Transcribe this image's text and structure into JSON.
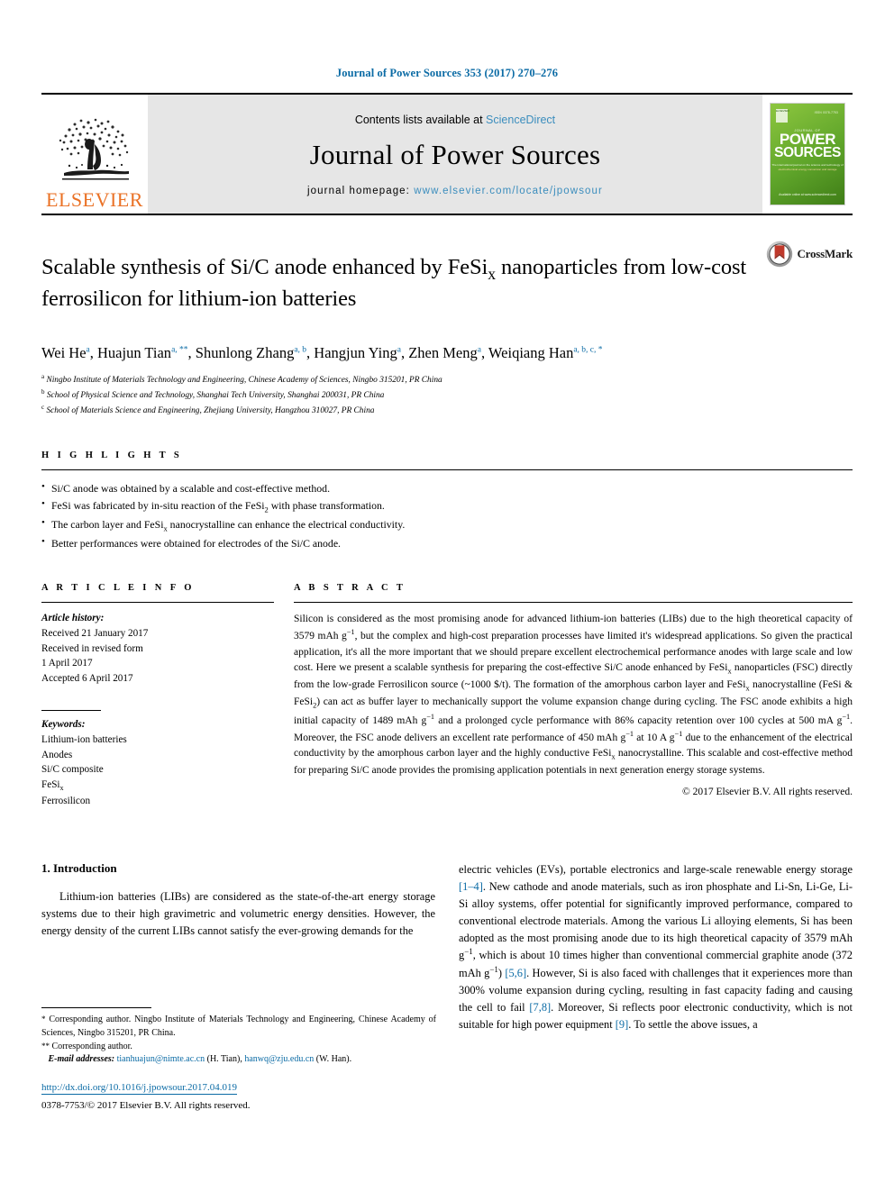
{
  "running_head": "Journal of Power Sources 353 (2017) 270–276",
  "masthead": {
    "publisher_wordmark": "ELSEVIER",
    "contents_prefix": "Contents lists available at ",
    "contents_link": "ScienceDirect",
    "journal_name": "Journal of Power Sources",
    "homepage_prefix": "journal homepage: ",
    "homepage_url": "www.elsevier.com/locate/jpowsour",
    "cover": {
      "publisher_mark": "ELSEVIER",
      "issn": "ISSN 0378-7753",
      "super_title": "JOURNAL OF",
      "title_line1": "POWER",
      "title_line2": "SOURCES",
      "tagline": "The international journal on the science and technology of",
      "tagline2": "electrochemical energy conversion and storage",
      "footer": "Available online at\nwww.sciencedirect.com"
    }
  },
  "article": {
    "title_part1": "Scalable synthesis of Si/C anode enhanced by FeSi",
    "title_sub": "x",
    "title_part2": " nanoparticles from low-cost ferrosilicon for lithium-ion batteries",
    "crossmark_label": "CrossMark",
    "authors": [
      {
        "name": "Wei He",
        "marks": "a",
        "sep": ", "
      },
      {
        "name": "Huajun Tian",
        "marks": "a, **",
        "sep": ", "
      },
      {
        "name": "Shunlong Zhang",
        "marks": "a, b",
        "sep": ", "
      },
      {
        "name": "Hangjun Ying",
        "marks": "a",
        "sep": ", "
      },
      {
        "name": "Zhen Meng",
        "marks": "a",
        "sep": ", "
      },
      {
        "name": "Weiqiang Han",
        "marks": "a, b, c, *",
        "sep": ""
      }
    ],
    "affiliations": [
      {
        "mark": "a",
        "text": "Ningbo Institute of Materials Technology and Engineering, Chinese Academy of Sciences, Ningbo 315201, PR China"
      },
      {
        "mark": "b",
        "text": "School of Physical Science and Technology, Shanghai Tech University, Shanghai 200031, PR China"
      },
      {
        "mark": "c",
        "text": "School of Materials Science and Engineering, Zhejiang University, Hangzhou 310027, PR China"
      }
    ]
  },
  "highlights": {
    "heading": "H I G H L I G H T S",
    "items": [
      "Si/C anode was obtained by a scalable and cost-effective method.",
      "FeSi was fabricated by in-situ reaction of the FeSi2 with phase transformation.",
      "The carbon layer and FeSix nanocrystalline can enhance the electrical conductivity.",
      "Better performances were obtained for electrodes of the Si/C anode."
    ]
  },
  "article_info": {
    "heading": "A R T I C L E   I N F O",
    "history_label": "Article history:",
    "history": [
      "Received 21 January 2017",
      "Received in revised form",
      "1 April 2017",
      "Accepted 6 April 2017"
    ],
    "keywords_label": "Keywords:",
    "keywords": [
      "Lithium-ion batteries",
      "Anodes",
      "Si/C composite",
      "FeSix",
      "Ferrosilicon"
    ]
  },
  "abstract": {
    "heading": "A B S T R A C T",
    "text": "Silicon is considered as the most promising anode for advanced lithium-ion batteries (LIBs) due to the high theoretical capacity of 3579 mAh g−1, but the complex and high-cost preparation processes have limited it's widespread applications. So given the practical application, it's all the more important that we should prepare excellent electrochemical performance anodes with large scale and low cost. Here we present a scalable synthesis for preparing the cost-effective Si/C anode enhanced by FeSix nanoparticles (FSC) directly from the low-grade Ferrosilicon source (~1000 $/t). The formation of the amorphous carbon layer and FeSix nanocrystalline (FeSi & FeSi2) can act as buffer layer to mechanically support the volume expansion change during cycling. The FSC anode exhibits a high initial capacity of 1489 mAh g−1 and a prolonged cycle performance with 86% capacity retention over 100 cycles at 500 mA g−1. Moreover, the FSC anode delivers an excellent rate performance of 450 mAh g−1 at 10 A g−1 due to the enhancement of the electrical conductivity by the amorphous carbon layer and the highly conductive FeSix nanocrystalline. This scalable and cost-effective method for preparing Si/C anode provides the promising application potentials in next generation energy storage systems.",
    "copyright": "© 2017 Elsevier B.V. All rights reserved."
  },
  "introduction": {
    "heading": "1. Introduction",
    "left_paragraph": "Lithium-ion batteries (LIBs) are considered as the state-of-the-art energy storage systems due to their high gravimetric and volumetric energy densities. However, the energy density of the current LIBs cannot satisfy the ever-growing demands for the",
    "right_paragraph": "electric vehicles (EVs), portable electronics and large-scale renewable energy storage [1–4]. New cathode and anode materials, such as iron phosphate and Li-Sn, Li-Ge, Li-Si alloy systems, offer potential for significantly improved performance, compared to conventional electrode materials. Among the various Li alloying elements, Si has been adopted as the most promising anode due to its high theoretical capacity of 3579 mAh g−1, which is about 10 times higher than conventional commercial graphite anode (372 mAh g−1) [5,6]. However, Si is also faced with challenges that it experiences more than 300% volume expansion during cycling, resulting in fast capacity fading and causing the cell to fail [7,8]. Moreover, Si reflects poor electronic conductivity, which is not suitable for high power equipment [9]. To settle the above issues, a",
    "references_cited": [
      "[1–4]",
      "[5,6]",
      "[7,8]",
      "[9]"
    ]
  },
  "footnotes": {
    "corresponding_1_mark": "*",
    "corresponding_1": "Corresponding author. Ningbo Institute of Materials Technology and Engineering, Chinese Academy of Sciences, Ningbo 315201, PR China.",
    "corresponding_2_mark": "**",
    "corresponding_2": "Corresponding author.",
    "email_label": "E-mail addresses:",
    "email_1": "tianhuajun@nimte.ac.cn",
    "email_1_who": "(H. Tian)",
    "email_2": "hanwq@zju.edu.cn",
    "email_2_who": "(W. Han).",
    "doi": "http://dx.doi.org/10.1016/j.jpowsour.2017.04.019",
    "issn_copyright": "0378-7753/© 2017 Elsevier B.V. All rights reserved."
  }
}
